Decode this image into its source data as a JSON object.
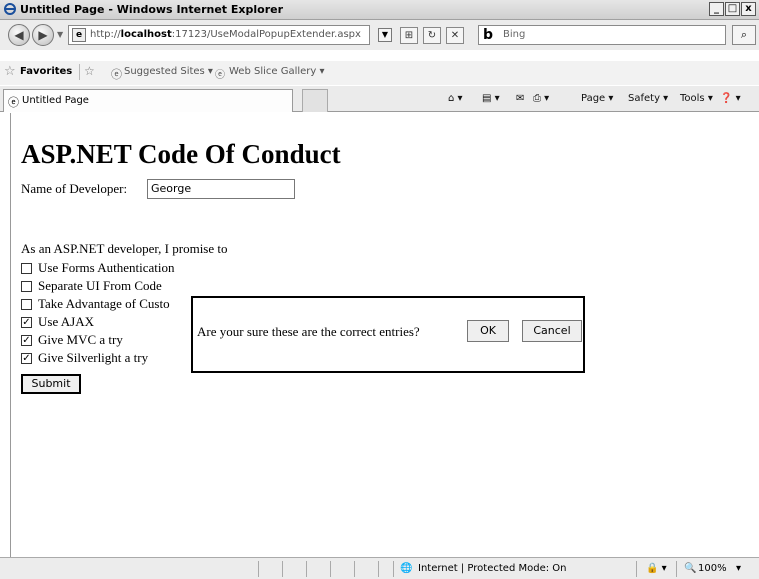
{
  "window": {
    "title": "Untitled Page - Windows Internet Explorer",
    "controls": [
      "_",
      "□",
      "x"
    ]
  },
  "address": {
    "host": "http://",
    "host_bold": "localhost",
    "path": ":17123/UseModalPopupExtender.aspx"
  },
  "search": {
    "placeholder": "Bing",
    "engine_icon": "b"
  },
  "favorites": {
    "label": "Favorites",
    "suggested": "Suggested Sites ▾",
    "web_slice": "Web Slice Gallery ▾"
  },
  "tab": {
    "label": "Untitled Page"
  },
  "commands": {
    "page": "Page ▾",
    "safety": "Safety ▾",
    "tools": "Tools ▾",
    "help": "❓ ▾"
  },
  "page": {
    "heading": "ASP.NET Code Of Conduct",
    "name_label": "Name of Developer:",
    "name_value": "George",
    "promise": "As an ASP.NET developer, I promise to",
    "items": [
      {
        "label": "Use Forms Authentication",
        "checked": false
      },
      {
        "label": "Separate UI From Code",
        "checked": false
      },
      {
        "label": "Take Advantage of Custo",
        "checked": false
      },
      {
        "label": "Use AJAX",
        "checked": true
      },
      {
        "label": "Give MVC a try",
        "checked": true
      },
      {
        "label": "Give Silverlight a try",
        "checked": true
      }
    ],
    "submit_label": "Submit"
  },
  "modal": {
    "message": "Are your sure these are the correct entries?",
    "ok_label": "OK",
    "cancel_label": "Cancel"
  },
  "status": {
    "zone": "Internet | Protected Mode: On",
    "zoom": "100%"
  }
}
